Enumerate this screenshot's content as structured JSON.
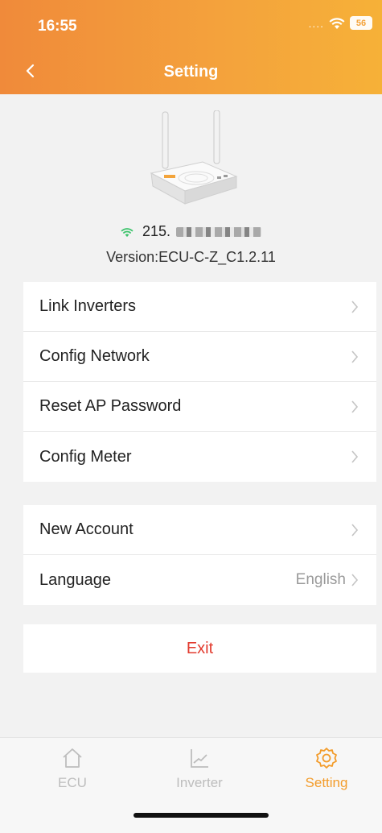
{
  "status": {
    "time": "16:55",
    "dots": "....",
    "battery": "56"
  },
  "nav": {
    "title": "Setting"
  },
  "device": {
    "ip": "215.",
    "version": "Version:ECU-C-Z_C1.2.11"
  },
  "group1": [
    {
      "label": "Link Inverters"
    },
    {
      "label": "Config Network"
    },
    {
      "label": "Reset AP Password"
    },
    {
      "label": "Config Meter"
    }
  ],
  "group2": [
    {
      "label": "New Account"
    },
    {
      "label": "Language",
      "value": "English"
    }
  ],
  "exit_label": "Exit",
  "tabs": [
    {
      "label": "ECU"
    },
    {
      "label": "Inverter"
    },
    {
      "label": "Setting"
    }
  ],
  "colors": {
    "accent": "#f39c2b",
    "exit": "#e23b2e",
    "wifi": "#3cc36b"
  }
}
